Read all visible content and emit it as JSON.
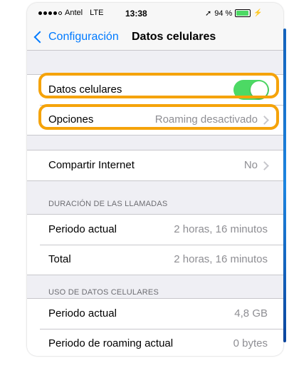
{
  "status_bar": {
    "carrier": "Antel",
    "network": "LTE",
    "time": "13:38",
    "location_glyph": "➚",
    "battery": "94 %",
    "battery_level": 0.94
  },
  "nav": {
    "back_label": "Configuración",
    "title": "Datos celulares"
  },
  "cellular": {
    "label": "Datos celulares",
    "enabled": true
  },
  "options": {
    "label": "Opciones",
    "value": "Roaming desactivado"
  },
  "hotspot": {
    "label": "Compartir Internet",
    "value": "No"
  },
  "call_duration": {
    "header": "DURACIÓN DE LAS LLAMADAS",
    "current_label": "Periodo actual",
    "current_value": "2 horas, 16 minutos",
    "total_label": "Total",
    "total_value": "2 horas, 16 minutos"
  },
  "data_usage": {
    "header": "USO DE DATOS CELULARES",
    "current_label": "Periodo actual",
    "current_value": "4,8 GB",
    "roaming_label": "Periodo de roaming actual",
    "roaming_value": "0 bytes"
  },
  "colors": {
    "accent": "#007aff",
    "toggle_on": "#4cd964",
    "highlight": "#f5a30a"
  }
}
